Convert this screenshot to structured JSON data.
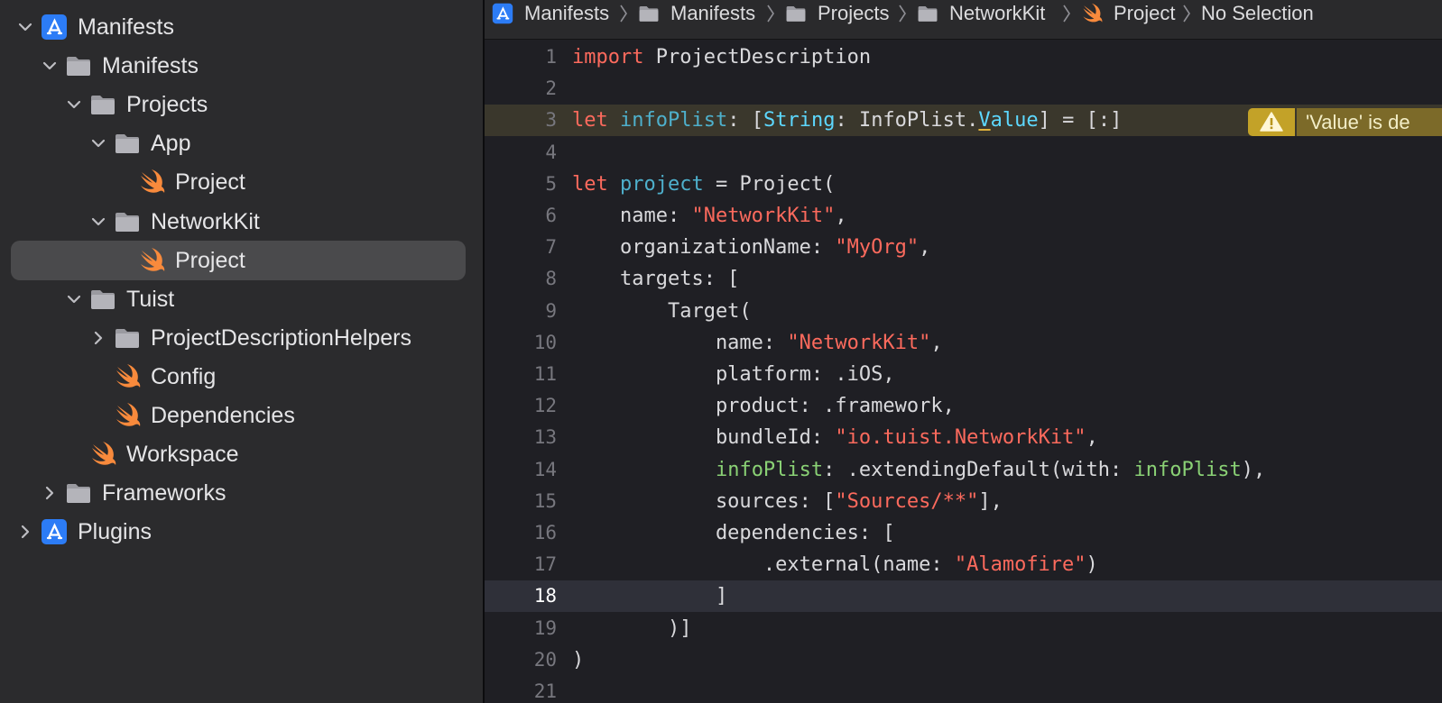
{
  "sidebar": {
    "items": [
      {
        "label": "Manifests",
        "icon": "app-project-icon",
        "chevron": "down"
      },
      {
        "label": "Manifests",
        "icon": "folder-icon",
        "chevron": "down"
      },
      {
        "label": "Projects",
        "icon": "folder-icon",
        "chevron": "down"
      },
      {
        "label": "App",
        "icon": "folder-icon",
        "chevron": "down"
      },
      {
        "label": "Project",
        "icon": "swift-file-icon"
      },
      {
        "label": "NetworkKit",
        "icon": "folder-icon",
        "chevron": "down"
      },
      {
        "label": "Project",
        "icon": "swift-file-icon",
        "selected": true
      },
      {
        "label": "Tuist",
        "icon": "folder-icon",
        "chevron": "down"
      },
      {
        "label": "ProjectDescriptionHelpers",
        "icon": "folder-icon",
        "chevron": "right"
      },
      {
        "label": "Config",
        "icon": "swift-file-icon"
      },
      {
        "label": "Dependencies",
        "icon": "swift-file-icon"
      },
      {
        "label": "Workspace",
        "icon": "swift-file-icon"
      },
      {
        "label": "Frameworks",
        "icon": "folder-icon",
        "chevron": "right"
      },
      {
        "label": "Plugins",
        "icon": "app-project-icon",
        "chevron": "right"
      }
    ]
  },
  "breadcrumb": {
    "items": [
      {
        "label": "Manifests",
        "icon": "app-project-icon"
      },
      {
        "label": "Manifests",
        "icon": "folder-icon"
      },
      {
        "label": "Projects",
        "icon": "folder-icon"
      },
      {
        "label": "NetworkKit",
        "icon": "folder-icon"
      },
      {
        "label": "Project",
        "icon": "swift-file-icon"
      },
      {
        "label": "No Selection"
      }
    ]
  },
  "editor": {
    "current_line": 18,
    "warning": {
      "line": 3,
      "message": "'Value' is de",
      "icon": "warning-triangle-icon",
      "color": "#c3a228"
    },
    "lines": [
      {
        "num": "1",
        "t": {
          "kw": "import",
          "rest": " ProjectDescription"
        }
      },
      {
        "num": "2"
      },
      {
        "num": "3",
        "t": {
          "kw": "let",
          "sp": " ",
          "name": "infoPlist",
          "p1": ": [",
          "type": "String",
          "p2": ": InfoPlist.",
          "u": "V",
          "val": "alue",
          "p3": "] = [:]"
        }
      },
      {
        "num": "4"
      },
      {
        "num": "5",
        "t": {
          "kw": "let",
          "sp": " ",
          "name": "project",
          "rest": " = Project("
        }
      },
      {
        "num": "6",
        "t": {
          "pre": "    name: ",
          "str": "\"NetworkKit\"",
          "post": ","
        }
      },
      {
        "num": "7",
        "t": {
          "pre": "    organizationName: ",
          "str": "\"MyOrg\"",
          "post": ","
        }
      },
      {
        "num": "8",
        "t": {
          "pre": "    targets: ["
        }
      },
      {
        "num": "9",
        "t": {
          "pre": "        Target("
        }
      },
      {
        "num": "10",
        "t": {
          "pre": "            name: ",
          "str": "\"NetworkKit\"",
          "post": ","
        }
      },
      {
        "num": "11",
        "t": {
          "pre": "            platform: .iOS,"
        }
      },
      {
        "num": "12",
        "t": {
          "pre": "            product: .framework,"
        }
      },
      {
        "num": "13",
        "t": {
          "pre": "            bundleId: ",
          "str": "\"io.tuist.NetworkKit\"",
          "post": ","
        }
      },
      {
        "num": "14",
        "t": {
          "pre": "            ",
          "g1": "infoPlist",
          "mid": ": .extendingDefault(with: ",
          "g2": "infoPlist",
          "post": "),"
        }
      },
      {
        "num": "15",
        "t": {
          "pre": "            sources: [",
          "str": "\"Sources/**\"",
          "post": "],"
        }
      },
      {
        "num": "16",
        "t": {
          "pre": "            dependencies: ["
        }
      },
      {
        "num": "17",
        "t": {
          "pre": "                .external(name: ",
          "str": "\"Alamofire\"",
          "post": ")"
        }
      },
      {
        "num": "18",
        "t": {
          "pre": "            ]"
        }
      },
      {
        "num": "19",
        "t": {
          "pre": "        )]"
        }
      },
      {
        "num": "20",
        "t": {
          "pre": ")"
        }
      },
      {
        "num": "21"
      }
    ]
  },
  "colors": {
    "keyword": "#fc6a5d",
    "string": "#fc6a5d",
    "type": "#5dd8ff",
    "declaration": "#4eb0cc",
    "project_ref": "#8ad175",
    "swift_icon": "#f88a3c",
    "project_icon": "#2c7cf6"
  }
}
